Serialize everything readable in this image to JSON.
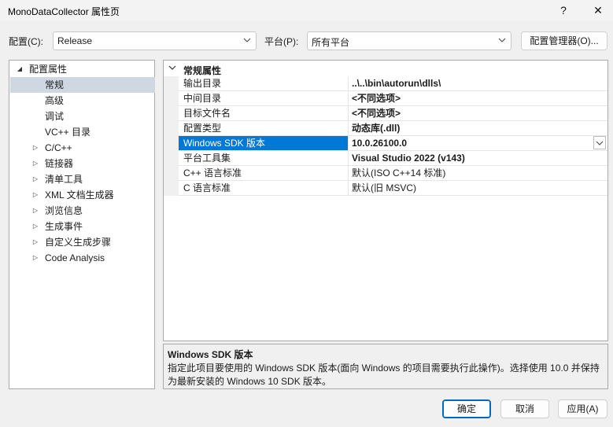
{
  "window": {
    "title": "MonoDataCollector 属性页",
    "help_glyph": "?",
    "close_glyph": "✕"
  },
  "toolbar": {
    "config_label": "配置(C):",
    "config_value": "Release",
    "platform_label": "平台(P):",
    "platform_value": "所有平台",
    "config_manager_label": "配置管理器(O)..."
  },
  "tree": {
    "items": [
      {
        "label": "配置属性",
        "expander": "◢",
        "level": 0
      },
      {
        "label": "常规",
        "expander": "",
        "level": 1,
        "selected": true
      },
      {
        "label": "高级",
        "expander": "",
        "level": 1
      },
      {
        "label": "调试",
        "expander": "",
        "level": 1
      },
      {
        "label": "VC++ 目录",
        "expander": "",
        "level": 1
      },
      {
        "label": "C/C++",
        "expander": "▷",
        "level": 1
      },
      {
        "label": "链接器",
        "expander": "▷",
        "level": 1
      },
      {
        "label": "清单工具",
        "expander": "▷",
        "level": 1
      },
      {
        "label": "XML 文档生成器",
        "expander": "▷",
        "level": 1
      },
      {
        "label": "浏览信息",
        "expander": "▷",
        "level": 1
      },
      {
        "label": "生成事件",
        "expander": "▷",
        "level": 1
      },
      {
        "label": "自定义生成步骤",
        "expander": "▷",
        "level": 1
      },
      {
        "label": "Code Analysis",
        "expander": "▷",
        "level": 1
      }
    ]
  },
  "grid": {
    "section": "常规属性",
    "rows": [
      {
        "name": "输出目录",
        "value": "..\\..\\bin\\autorun\\dlls\\"
      },
      {
        "name": "中间目录",
        "value": "<不同选项>"
      },
      {
        "name": "目标文件名",
        "value": "<不同选项>"
      },
      {
        "name": "配置类型",
        "value": "动态库(.dll)"
      },
      {
        "name": "Windows SDK 版本",
        "value": "10.0.26100.0",
        "selected": true
      },
      {
        "name": "平台工具集",
        "value": "Visual Studio 2022 (v143)"
      },
      {
        "name": "C++ 语言标准",
        "value": "默认(ISO C++14 标准)",
        "plain": true
      },
      {
        "name": "C 语言标准",
        "value": "默认(旧 MSVC)",
        "plain": true
      }
    ]
  },
  "description": {
    "title": "Windows SDK 版本",
    "text": "指定此项目要使用的 Windows SDK 版本(面向 Windows 的项目需要执行此操作)。选择使用 10.0 并保持为最新安装的 Windows 10 SDK 版本。"
  },
  "buttons": {
    "ok": "确定",
    "cancel": "取消",
    "apply": "应用(A)"
  }
}
